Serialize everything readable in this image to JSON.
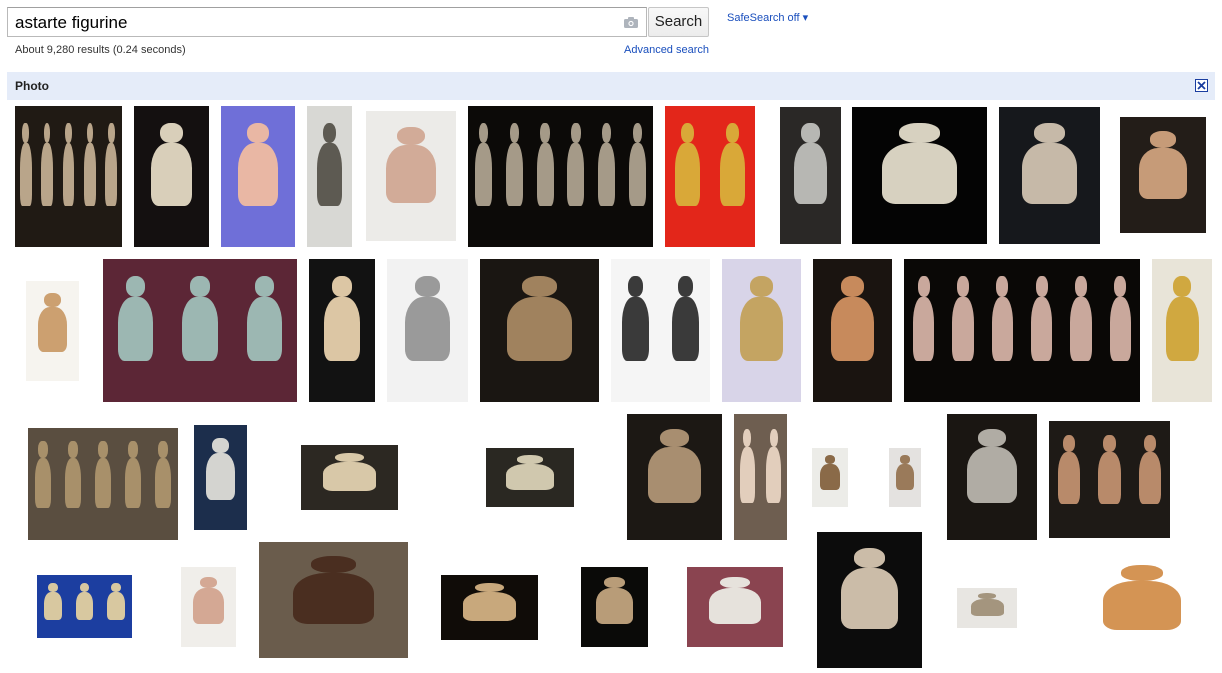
{
  "search": {
    "query": "astarte figurine",
    "button_label": "Search"
  },
  "safesearch": {
    "label": "SafeSearch off ▾"
  },
  "results": {
    "stats": "About 9,280 results (0.24 seconds)",
    "advanced_label": "Advanced search"
  },
  "filter": {
    "title": "Photo",
    "close_icon": "close-icon"
  },
  "theme": {
    "link_color": "#1a4fbd",
    "bar_color": "#e5ecf9"
  },
  "thumbnails": [
    {
      "bg": "#201a14",
      "fig": "#b9a58a",
      "n": 5
    },
    {
      "bg": "#141010",
      "fig": "#d9cfba",
      "n": 1
    },
    {
      "bg": "#6f6fd8",
      "fig": "#e9b7a4",
      "n": 1
    },
    {
      "bg": "#d8d8d4",
      "fig": "#5d5a52",
      "n": 1
    },
    {
      "bg": "#ecebe8",
      "fig": "#d2ab98",
      "n": 1
    },
    {
      "bg": "#0c0a08",
      "fig": "#a59a88",
      "n": 6
    },
    {
      "bg": "#e3261a",
      "fig": "#d9a838",
      "n": 2
    },
    {
      "bg": "#2a2826",
      "fig": "#b7b7b3",
      "n": 1
    },
    {
      "bg": "#040404",
      "fig": "#d7d1c0",
      "n": 1
    },
    {
      "bg": "#16181c",
      "fig": "#c6b9a8",
      "n": 1
    },
    {
      "bg": "#231d18",
      "fig": "#c69b78",
      "n": 1
    },
    {
      "bg": "#f6f4ef",
      "fig": "#cca070",
      "n": 1
    },
    {
      "bg": "#5c2636",
      "fig": "#9cb7b2",
      "n": 3
    },
    {
      "bg": "#121212",
      "fig": "#dcc6a4",
      "n": 1
    },
    {
      "bg": "#f2f2f2",
      "fig": "#9a9a9a",
      "n": 1
    },
    {
      "bg": "#1a1612",
      "fig": "#a0825e",
      "n": 1
    },
    {
      "bg": "#f5f5f5",
      "fig": "#3a3a3a",
      "n": 2
    },
    {
      "bg": "#d8d4e8",
      "fig": "#c4a462",
      "n": 1
    },
    {
      "bg": "#1a1410",
      "fig": "#c78a5c",
      "n": 1
    },
    {
      "bg": "#0a0806",
      "fig": "#c9a89c",
      "n": 6
    },
    {
      "bg": "#e8e4d8",
      "fig": "#d0a840",
      "n": 1
    },
    {
      "bg": "#5a4e40",
      "fig": "#a8906a",
      "n": 5
    },
    {
      "bg": "#1c2e4c",
      "fig": "#d4d4d0",
      "n": 1
    },
    {
      "bg": "#2c2822",
      "fig": "#d8c8a8",
      "n": 1
    },
    {
      "bg": "#2a2822",
      "fig": "#d0c8ae",
      "n": 1
    },
    {
      "bg": "#1c1814",
      "fig": "#a88e70",
      "n": 1
    },
    {
      "bg": "#6e5e50",
      "fig": "#e2cebc",
      "n": 2
    },
    {
      "bg": "#ecece8",
      "fig": "#8a6a48",
      "n": 1
    },
    {
      "bg": "#e4e2e0",
      "fig": "#9a7a5a",
      "n": 1
    },
    {
      "bg": "#1a1612",
      "fig": "#b0aca4",
      "n": 1
    },
    {
      "bg": "#1e1a16",
      "fig": "#b88a6a",
      "n": 3
    },
    {
      "bg": "#1c3ea0",
      "fig": "#d8c8a0",
      "n": 3
    },
    {
      "bg": "#f0eeea",
      "fig": "#d4a894",
      "n": 1
    },
    {
      "bg": "#6a5c4c",
      "fig": "#4a2e20",
      "n": 1
    },
    {
      "bg": "#100c08",
      "fig": "#c8a87c",
      "n": 1
    },
    {
      "bg": "#0a0a08",
      "fig": "#b89c78",
      "n": 1
    },
    {
      "bg": "#8a4450",
      "fig": "#e6e2dc",
      "n": 1
    },
    {
      "bg": "#0c0c0c",
      "fig": "#cbbca8",
      "n": 1
    },
    {
      "bg": "#e8e6e2",
      "fig": "#a4957e",
      "n": 1
    },
    {
      "bg": "#ffffff",
      "fig": "#d49454",
      "n": 1
    }
  ]
}
